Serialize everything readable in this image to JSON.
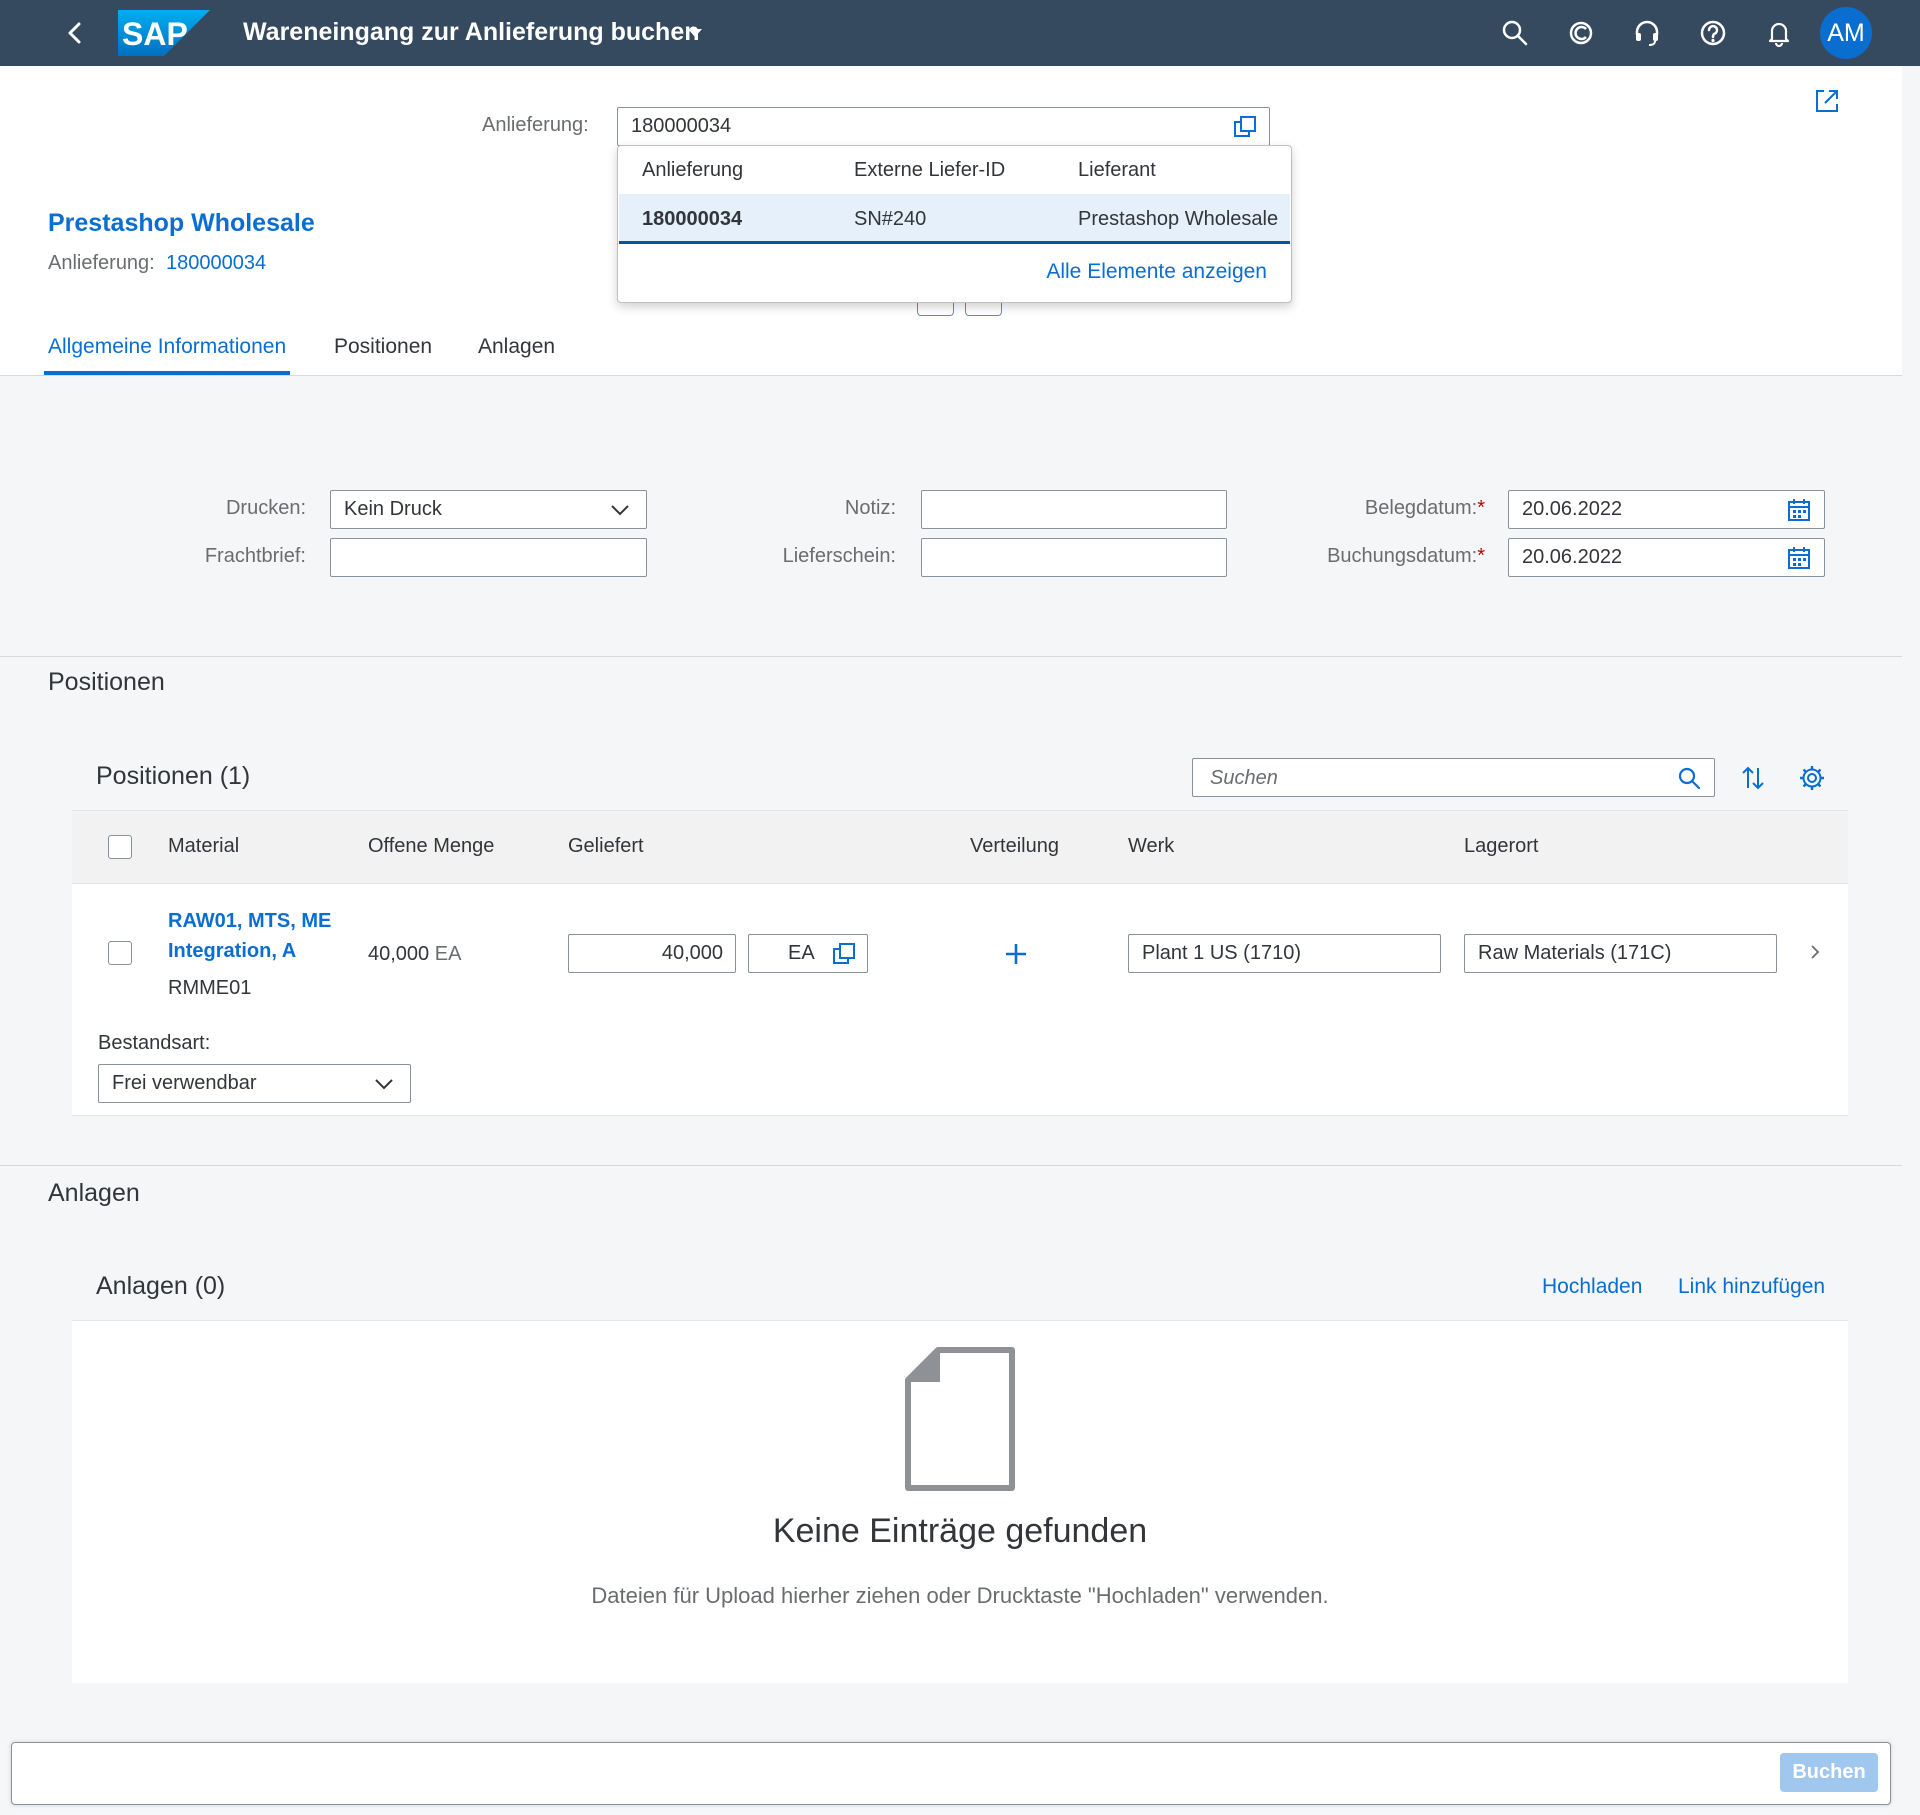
{
  "shell": {
    "brand": "SAP",
    "title": "Wareneingang zur Anlieferung buchen",
    "avatar_initials": "AM",
    "icons": [
      "back-icon",
      "search-icon",
      "copilot-icon",
      "headset-icon",
      "help-icon",
      "bell-icon"
    ]
  },
  "header": {
    "anlieferung_label": "Anlieferung:",
    "anlieferung_value": "180000034",
    "object_title": "Prestashop Wholesale",
    "object_sub_label": "Anlieferung:",
    "object_sub_value": "180000034"
  },
  "suggestions": {
    "columns": [
      "Anlieferung",
      "Externe Liefer-ID",
      "Lieferant"
    ],
    "rows": [
      {
        "anlieferung": "180000034",
        "extern": "SN#240",
        "lieferant": "Prestashop Wholesale"
      }
    ],
    "show_all": "Alle Elemente anzeigen"
  },
  "tabs": [
    {
      "label": "Allgemeine Informationen",
      "active": true
    },
    {
      "label": "Positionen",
      "active": false
    },
    {
      "label": "Anlagen",
      "active": false
    }
  ],
  "form": {
    "drucken_label": "Drucken:",
    "drucken_value": "Kein Druck",
    "frachtbrief_label": "Frachtbrief:",
    "frachtbrief_value": "",
    "notiz_label": "Notiz:",
    "notiz_value": "",
    "lieferschein_label": "Lieferschein:",
    "lieferschein_value": "",
    "belegdatum_label": "Belegdatum:",
    "belegdatum_value": "20.06.2022",
    "buchungsdatum_label": "Buchungsdatum:",
    "buchungsdatum_value": "20.06.2022",
    "required_mark": "*"
  },
  "positionen": {
    "section_title": "Positionen",
    "table_title": "Positionen (1)",
    "search_placeholder": "Suchen",
    "columns": [
      "Material",
      "Offene Menge",
      "Geliefert",
      "Verteilung",
      "Werk",
      "Lagerort"
    ],
    "rows": [
      {
        "material_line1": "RAW01, MTS, ME",
        "material_line2": "Integration, A",
        "material_id": "RMME01",
        "offene_menge": "40,000",
        "offene_einheit": "EA",
        "geliefert": "40,000",
        "einheit": "EA",
        "werk": "Plant 1 US (1710)",
        "lagerort": "Raw Materials (171C)",
        "bestandsart_label": "Bestandsart:",
        "bestandsart_value": "Frei verwendbar"
      }
    ]
  },
  "anlagen": {
    "section_title": "Anlagen",
    "card_title": "Anlagen (0)",
    "upload": "Hochladen",
    "add_link": "Link hinzufügen",
    "empty_title": "Keine Einträge gefunden",
    "empty_text": "Dateien für Upload hierher ziehen oder Drucktaste \"Hochladen\" verwenden."
  },
  "footer": {
    "buchen": "Buchen"
  }
}
